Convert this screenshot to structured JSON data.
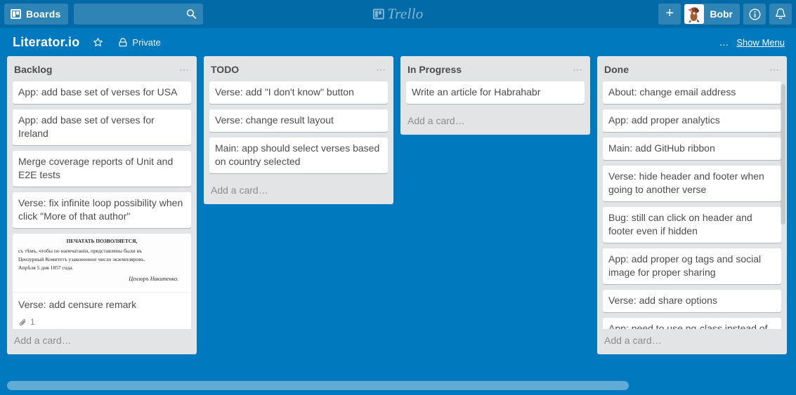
{
  "header": {
    "boards_label": "Boards",
    "boards_icon": "board-icon",
    "search_placeholder": "",
    "search_value": "",
    "search_icon": "search-icon",
    "brand_name": "Trello",
    "brand_icon": "board-icon",
    "add_label": "+",
    "member_name": "Bobr",
    "avatar_icon": "beaver-avatar",
    "info_icon": "info-circle-icon",
    "notifications_icon": "bell-icon"
  },
  "board": {
    "title": "Literator.io",
    "star_icon": "star-icon",
    "visibility_icon": "lock-icon",
    "visibility_label": "Private",
    "menu_dots": "…",
    "show_menu_label": "Show Menu"
  },
  "lists": [
    {
      "title": "Backlog",
      "menu_icon": "list-menu-icon",
      "add_card_label": "Add a card…",
      "has_scrollbar": false,
      "cards": [
        {
          "title": "App: add base set of verses for USA"
        },
        {
          "title": "App: add base set of verses for Ireland"
        },
        {
          "title": "Merge coverage reports of Unit and E2E tests"
        },
        {
          "title": "Verse: fix infinite loop possibility when click \"More of that author\""
        },
        {
          "title": "Verse: add censure remark",
          "cover": {
            "type": "censure-scan",
            "alt": "scanned 1857 Russian censorship permission note",
            "lines": [
              "ПЕЧАТАТЬ ПОЗВОЛЯЕТСЯ,",
              "съ тѣмъ, чтобы по напечатаніи, представлены были въ",
              "Цензурный Комитетъ узаконенное число экземпляровъ.",
              "Апрѣля 5 дня 1857 года.",
              "Цензоръ Никитенко."
            ]
          },
          "badges": {
            "attachment_icon": "paperclip-icon",
            "attachment_count": "1"
          }
        }
      ]
    },
    {
      "title": "TODO",
      "menu_icon": "list-menu-icon",
      "add_card_label": "Add a card…",
      "has_scrollbar": false,
      "cards": [
        {
          "title": "Verse: add \"I don't know\" button"
        },
        {
          "title": "Verse: change result layout"
        },
        {
          "title": "Main: app should select verses based on country selected"
        }
      ]
    },
    {
      "title": "In Progress",
      "menu_icon": "list-menu-icon",
      "add_card_label": "Add a card…",
      "has_scrollbar": false,
      "cards": [
        {
          "title": "Write an article for Habrahabr"
        }
      ]
    },
    {
      "title": "Done",
      "menu_icon": "list-menu-icon",
      "add_card_label": "Add a card…",
      "has_scrollbar": true,
      "cards": [
        {
          "title": "About: change email address"
        },
        {
          "title": "App: add proper analytics"
        },
        {
          "title": "Main: add GitHub ribbon"
        },
        {
          "title": "Verse: hide header and footer when going to another verse"
        },
        {
          "title": "Bug: still can click on header and footer even if hidden"
        },
        {
          "title": "App: add proper og tags and social image for proper sharing"
        },
        {
          "title": "Verse: add share options"
        },
        {
          "title": "App: need to use ng-class instead of direct CSS manipulation in header and footer show/hide mechanism"
        }
      ]
    }
  ],
  "colors": {
    "top_bar": "#026aa7",
    "board_background": "#0079bf",
    "list_background": "#e2e4e6",
    "card_background": "#ffffff",
    "text_primary": "#4d4d4d"
  }
}
